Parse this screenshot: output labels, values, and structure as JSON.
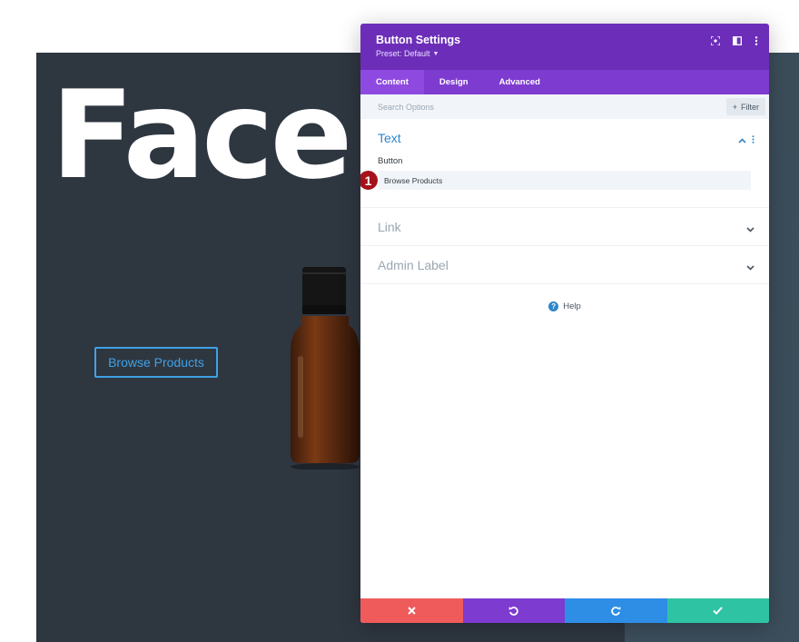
{
  "page": {
    "hero_title": "Face",
    "cta_label": "Browse Products"
  },
  "modal": {
    "title": "Button Settings",
    "preset": "Preset: Default",
    "header_icons": [
      "focus-icon",
      "split-view-icon",
      "more-vertical-icon"
    ],
    "tabs": [
      {
        "label": "Content",
        "active": true
      },
      {
        "label": "Design",
        "active": false
      },
      {
        "label": "Advanced",
        "active": false
      }
    ],
    "search": {
      "placeholder": "Search Options",
      "filter_label": "Filter"
    },
    "sections": [
      {
        "title": "Text",
        "open": true
      },
      {
        "title": "Link",
        "open": false
      },
      {
        "title": "Admin Label",
        "open": false
      }
    ],
    "text_section": {
      "field_label": "Button",
      "field_value": "Browse Products",
      "marker": "1"
    },
    "help_label": "Help",
    "footer": [
      "close-icon",
      "undo-icon",
      "redo-icon",
      "check-icon"
    ]
  },
  "colors": {
    "modal_header": "#6c2eb9",
    "tabs_bar": "#7e3bd0",
    "active_section": "#2e86c9",
    "cta_accent": "#3fa2e6",
    "cancel": "#ef5b5b",
    "undo": "#7e3bd0",
    "redo": "#2e8ee6",
    "save": "#2ec4a3",
    "marker": "#a5121b"
  }
}
